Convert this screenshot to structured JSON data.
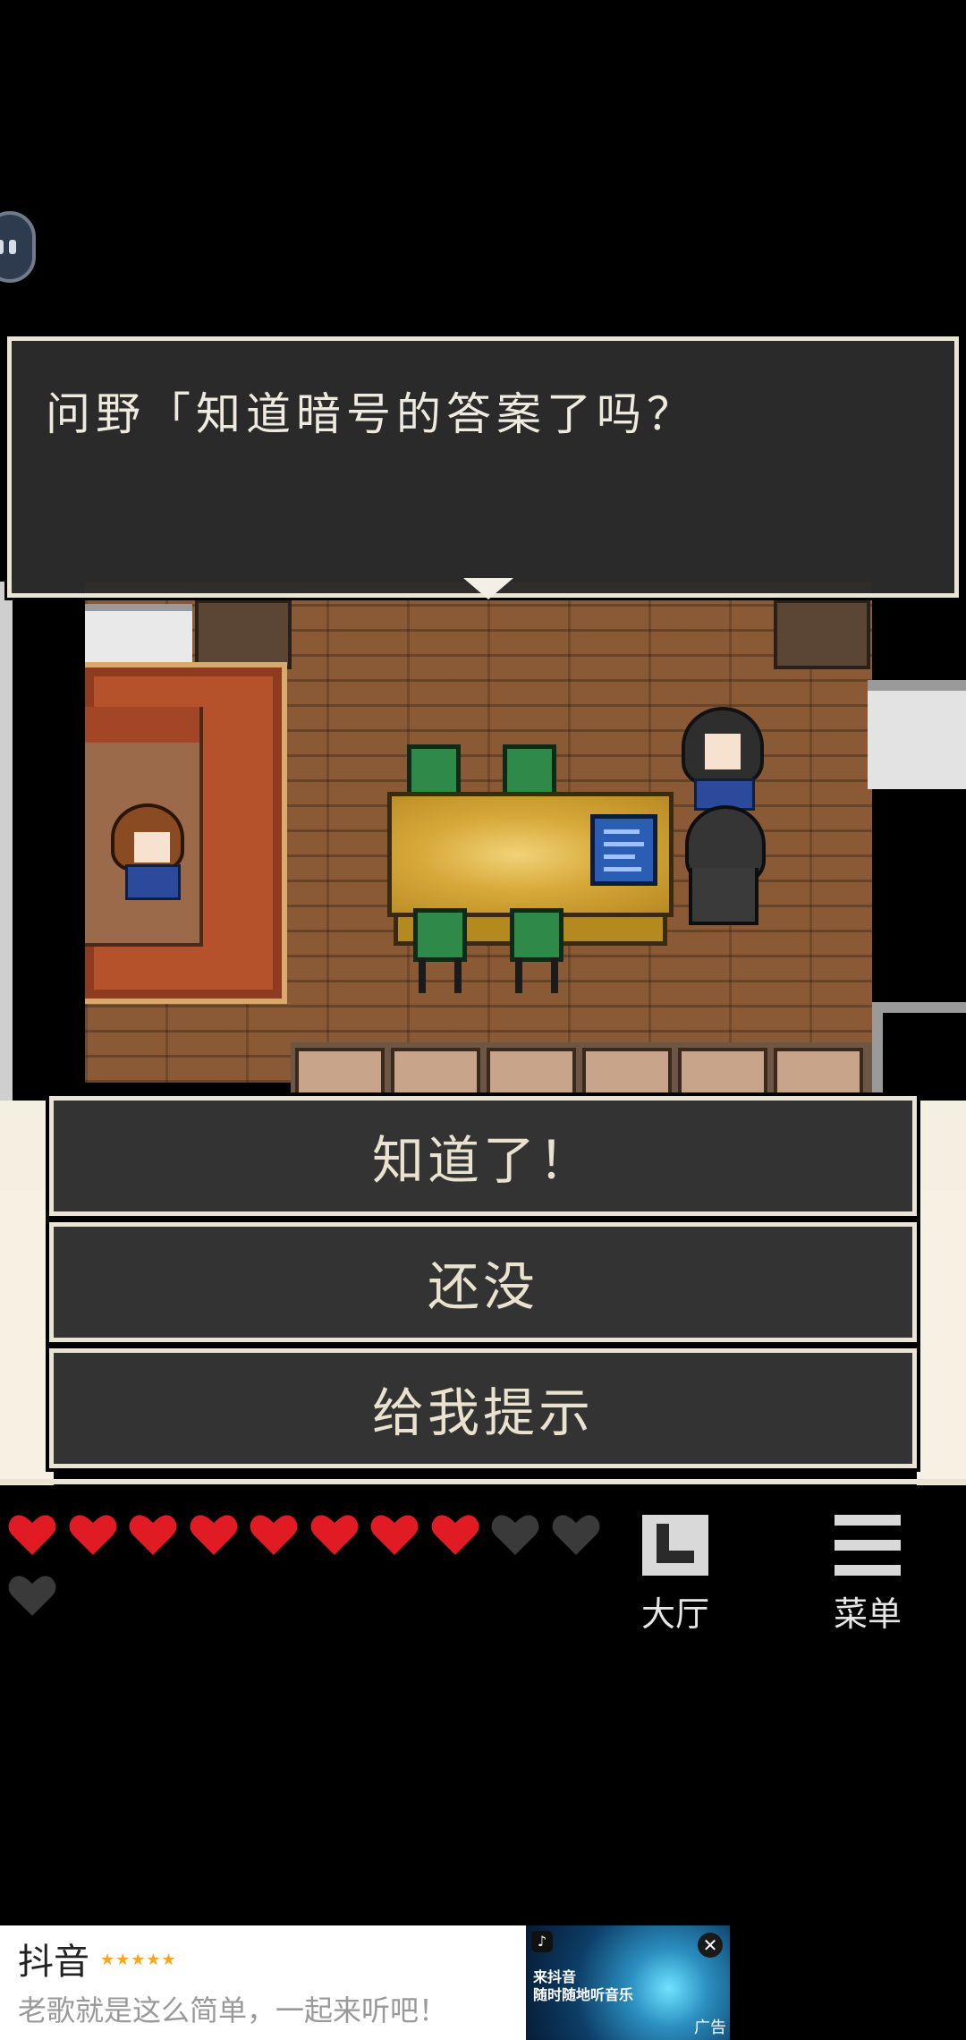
{
  "dialog": {
    "text": "问野「知道暗号的答案了吗？"
  },
  "choices": [
    {
      "label": "知道了！"
    },
    {
      "label": "还没"
    },
    {
      "label": "给我提示"
    }
  ],
  "hud": {
    "hearts_total": 11,
    "hearts_full": 8,
    "heart_full_color": "#e01b24",
    "heart_empty_color": "#3a3a3a",
    "lobby_label": "大厅",
    "menu_label": "菜单"
  },
  "ad": {
    "title": "抖音",
    "rating_stars": "★★★★★",
    "description": "老歌就是这么简单，一起来听吧！",
    "image_line1": "来抖音",
    "image_line2": "随时随地听音乐",
    "ad_tag": "广告",
    "close_label": "✕"
  }
}
